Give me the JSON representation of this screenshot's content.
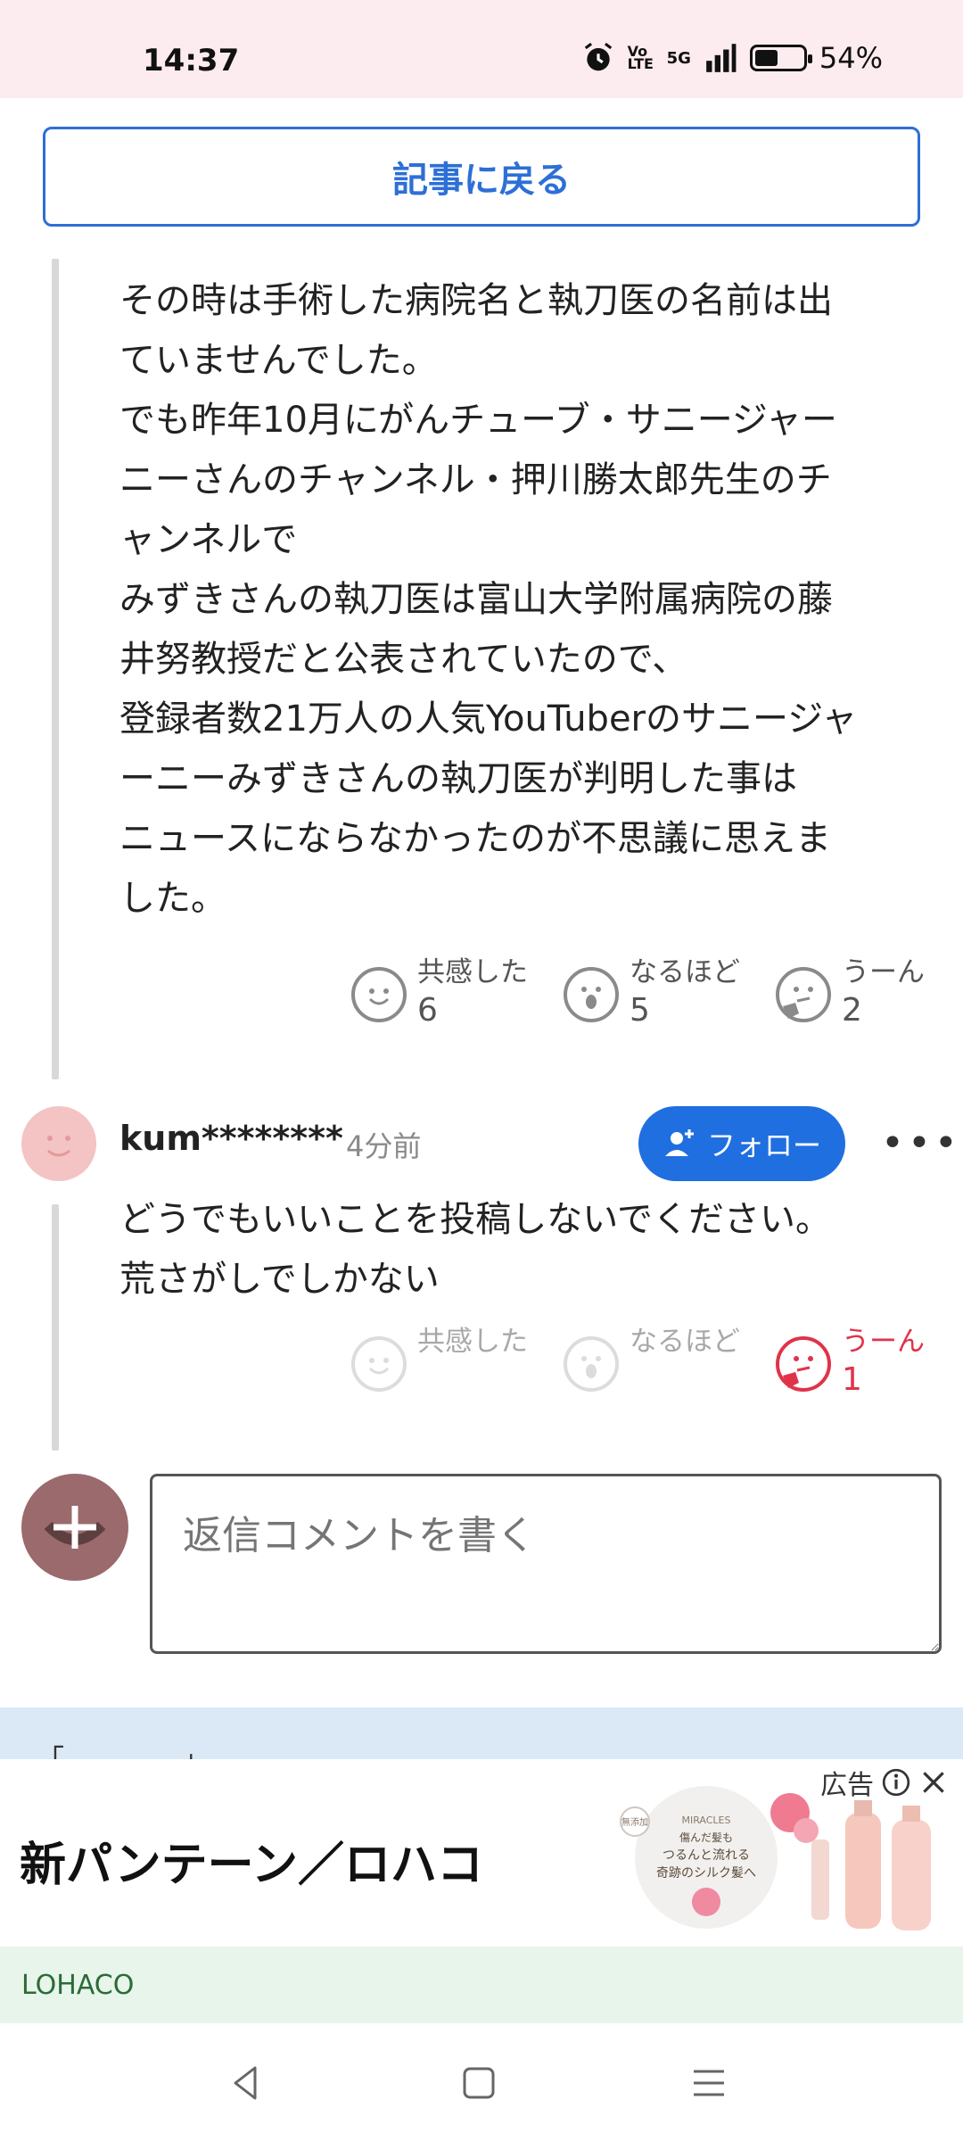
{
  "status": {
    "time": "14:37",
    "battery": "54%",
    "network": "5G",
    "volte": "Vo LTE",
    "battery_level": 0.54
  },
  "back_button": "記事に戻る",
  "comment1": {
    "text": "その時は手術した病院名と執刀医の名前は出\nていませんでした。\nでも昨年10月にがんチューブ・サニージャー\nニーさんのチャンネル・押川勝太郎先生のチ\nャンネルで\nみずきさんの執刀医は富山大学附属病院の藤\n井努教授だと公表されていたので、\n登録者数21万人の人気YouTuberのサニージャ\nーニーみずきさんの執刀医が判明した事は\nニュースにならなかったのが不思議に思えま\nした。",
    "reactions": [
      {
        "label": "共感した",
        "count": "6"
      },
      {
        "label": "なるほど",
        "count": "5"
      },
      {
        "label": "うーん",
        "count": "2"
      }
    ]
  },
  "comment2": {
    "username": "kum********",
    "time_ago": "4分前",
    "follow_label": "フォロー",
    "more_label": "•••",
    "text": "どうでもいいことを投稿しないでください。\n荒さがしでしかない",
    "reactions": [
      {
        "label": "共感した",
        "count": ""
      },
      {
        "label": "なるほど",
        "count": ""
      },
      {
        "label": "うーん",
        "count": "1"
      }
    ]
  },
  "reply": {
    "placeholder": "返信コメントを書く"
  },
  "band_text": "「 ... ... ... 」",
  "ad": {
    "label": "広告",
    "title": "新パンテーン／ロハコ",
    "brand": "LOHACO",
    "image_text": [
      "無添加",
      "MIRACLES",
      "傷んだ髪も",
      "つるんと流れる",
      "奇跡のシルク髪へ"
    ]
  },
  "colors": {
    "accent": "#2d6fd6",
    "follow": "#1f6fe0",
    "active_reaction": "#e0334a"
  }
}
